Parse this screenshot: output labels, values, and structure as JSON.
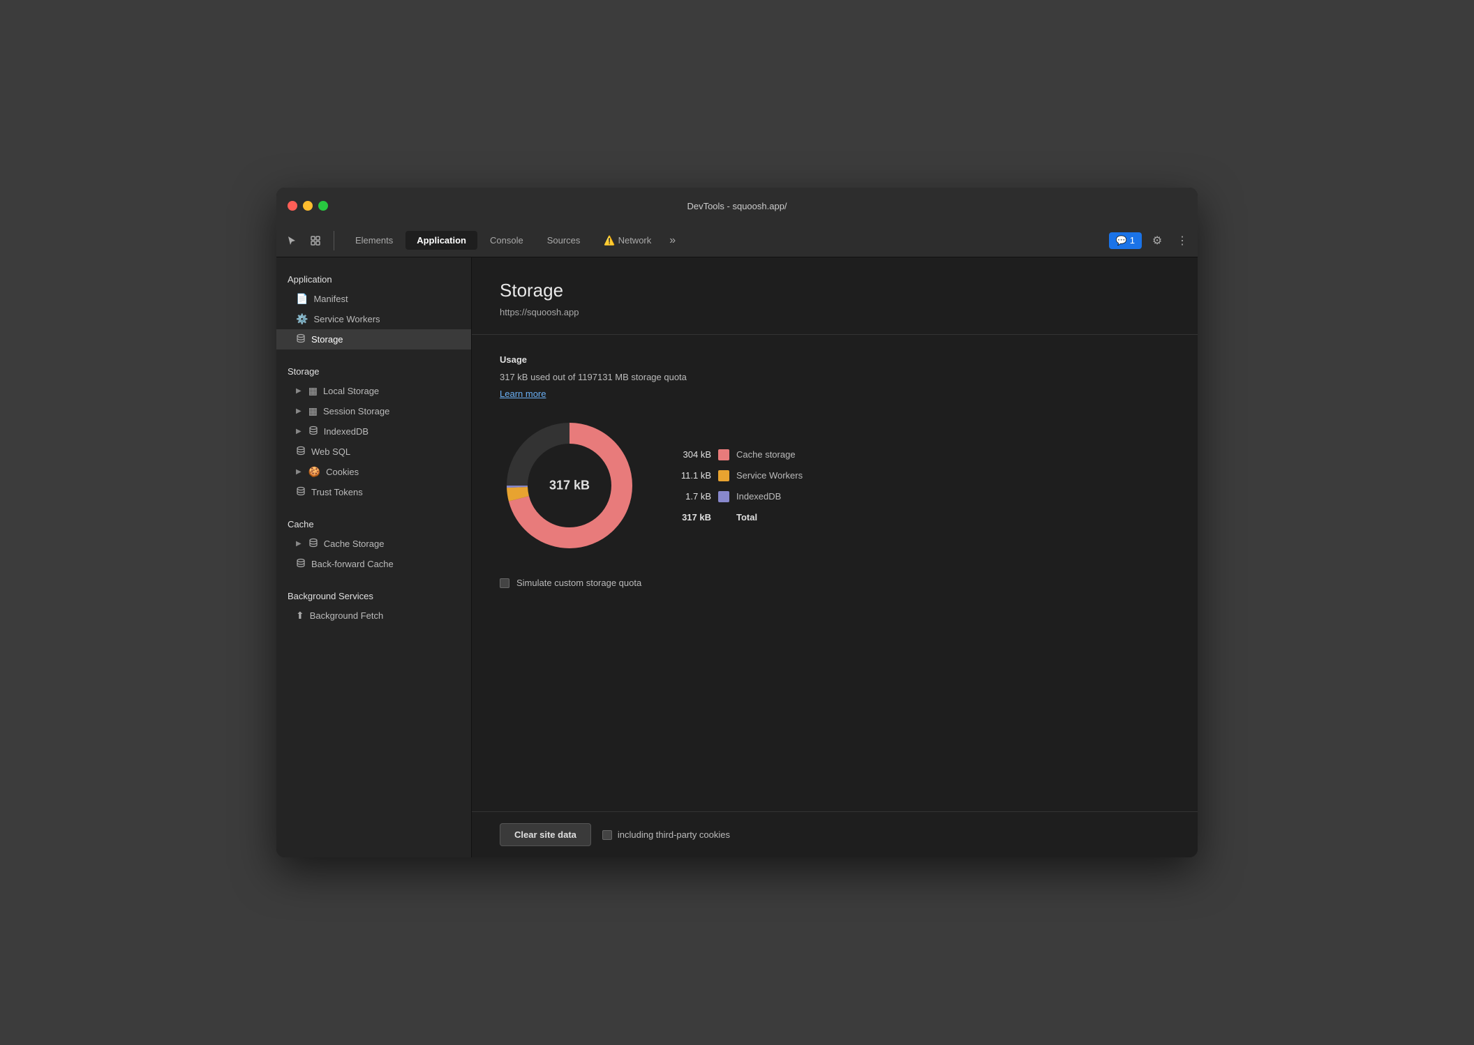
{
  "window": {
    "title": "DevTools - squoosh.app/"
  },
  "tabs": [
    {
      "id": "elements",
      "label": "Elements",
      "active": false
    },
    {
      "id": "application",
      "label": "Application",
      "active": true
    },
    {
      "id": "console",
      "label": "Console",
      "active": false
    },
    {
      "id": "sources",
      "label": "Sources",
      "active": false
    },
    {
      "id": "network",
      "label": "Network",
      "active": false,
      "warning": true
    }
  ],
  "tab_more": "»",
  "badge": {
    "icon": "💬",
    "count": "1"
  },
  "sidebar": {
    "sections": [
      {
        "label": "Application",
        "items": [
          {
            "id": "manifest",
            "label": "Manifest",
            "icon": "📄",
            "indent": false
          },
          {
            "id": "service-workers",
            "label": "Service Workers",
            "icon": "⚙️",
            "indent": false
          },
          {
            "id": "storage",
            "label": "Storage",
            "icon": "🗄",
            "indent": false,
            "active": true
          }
        ]
      },
      {
        "label": "Storage",
        "items": [
          {
            "id": "local-storage",
            "label": "Local Storage",
            "icon": "▦",
            "arrow": true
          },
          {
            "id": "session-storage",
            "label": "Session Storage",
            "icon": "▦",
            "arrow": true
          },
          {
            "id": "indexeddb",
            "label": "IndexedDB",
            "icon": "🗄",
            "arrow": true
          },
          {
            "id": "web-sql",
            "label": "Web SQL",
            "icon": "🗄",
            "arrow": false
          },
          {
            "id": "cookies",
            "label": "Cookies",
            "icon": "🍪",
            "arrow": true
          },
          {
            "id": "trust-tokens",
            "label": "Trust Tokens",
            "icon": "🗄",
            "arrow": false
          }
        ]
      },
      {
        "label": "Cache",
        "items": [
          {
            "id": "cache-storage",
            "label": "Cache Storage",
            "icon": "🗄",
            "arrow": true
          },
          {
            "id": "back-forward-cache",
            "label": "Back-forward Cache",
            "icon": "🗄",
            "arrow": false
          }
        ]
      },
      {
        "label": "Background Services",
        "items": [
          {
            "id": "background-fetch",
            "label": "Background Fetch",
            "icon": "⬆",
            "arrow": false
          }
        ]
      }
    ]
  },
  "content": {
    "title": "Storage",
    "url": "https://squoosh.app",
    "usage_section": "Usage",
    "usage_text": "317 kB used out of 1197131 MB storage quota",
    "learn_more": "Learn more",
    "chart_center_label": "317 kB",
    "legend": [
      {
        "size": "304 kB",
        "label": "Cache storage",
        "color": "#e87b7b"
      },
      {
        "size": "11.1 kB",
        "label": "Service Workers",
        "color": "#e8a330"
      },
      {
        "size": "1.7 kB",
        "label": "IndexedDB",
        "color": "#8888cc"
      }
    ],
    "total_size": "317 kB",
    "total_label": "Total",
    "simulate_label": "Simulate custom storage quota",
    "clear_btn": "Clear site data",
    "cookies_label": "including third-party cookies"
  }
}
